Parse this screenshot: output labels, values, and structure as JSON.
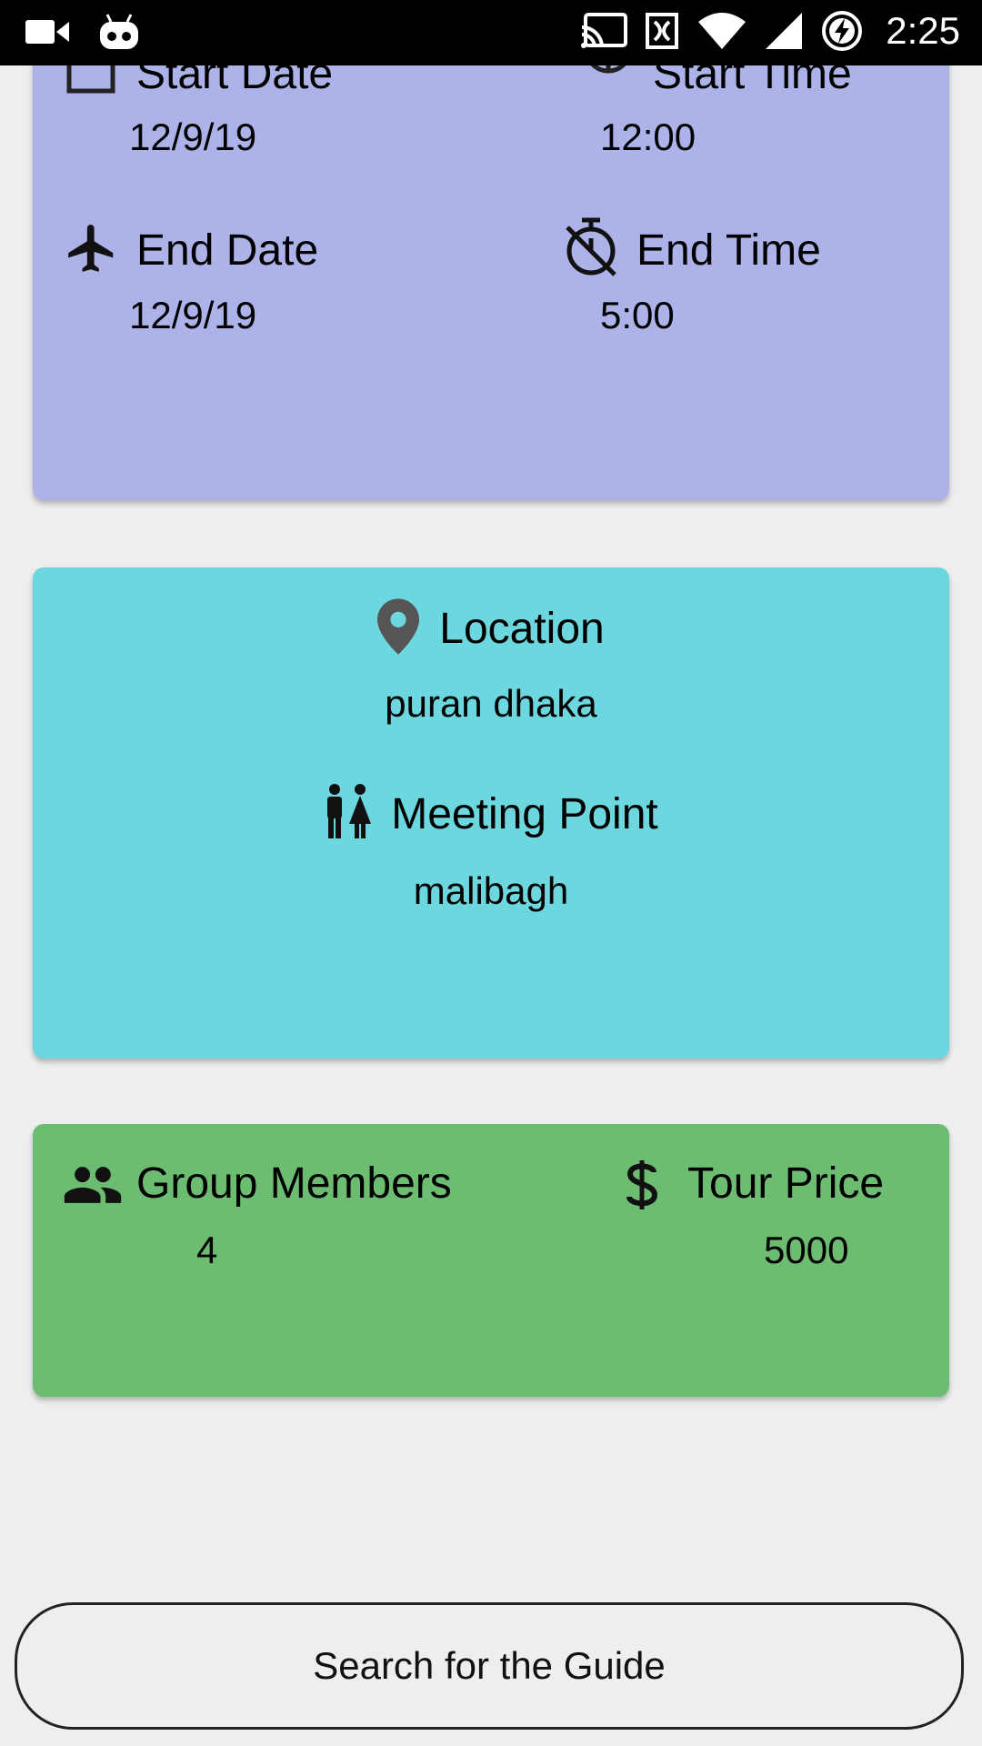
{
  "status_bar": {
    "time": "2:25",
    "icons": [
      "videocam-icon",
      "android-robot-icon",
      "cast-icon",
      "nfc-icon",
      "wifi-icon",
      "signal-icon",
      "battery-charging-icon"
    ]
  },
  "dates_card": {
    "color": "#adb3e8",
    "start_date": {
      "label": "Start Date",
      "value": "12/9/19",
      "icon": "calendar-icon"
    },
    "start_time": {
      "label": "Start Time",
      "value": "12:00",
      "icon": "timer-icon"
    },
    "end_date": {
      "label": "End Date",
      "value": "12/9/19",
      "icon": "airplane-icon"
    },
    "end_time": {
      "label": "End Time",
      "value": "5:00",
      "icon": "timer-off-icon"
    }
  },
  "location_card": {
    "color": "#6dd7e0",
    "location": {
      "label": "Location",
      "value": "puran dhaka",
      "icon": "location-pin-icon"
    },
    "meeting_point": {
      "label": "Meeting Point",
      "value": "malibagh",
      "icon": "people-icon"
    }
  },
  "group_card": {
    "color": "#6cbd72",
    "group_members": {
      "label": "Group Members",
      "value": "4",
      "icon": "group-icon"
    },
    "tour_price": {
      "label": "Tour Price",
      "value": "5000",
      "icon": "dollar-icon"
    }
  },
  "action": {
    "search_button_label": "Search for the Guide"
  }
}
